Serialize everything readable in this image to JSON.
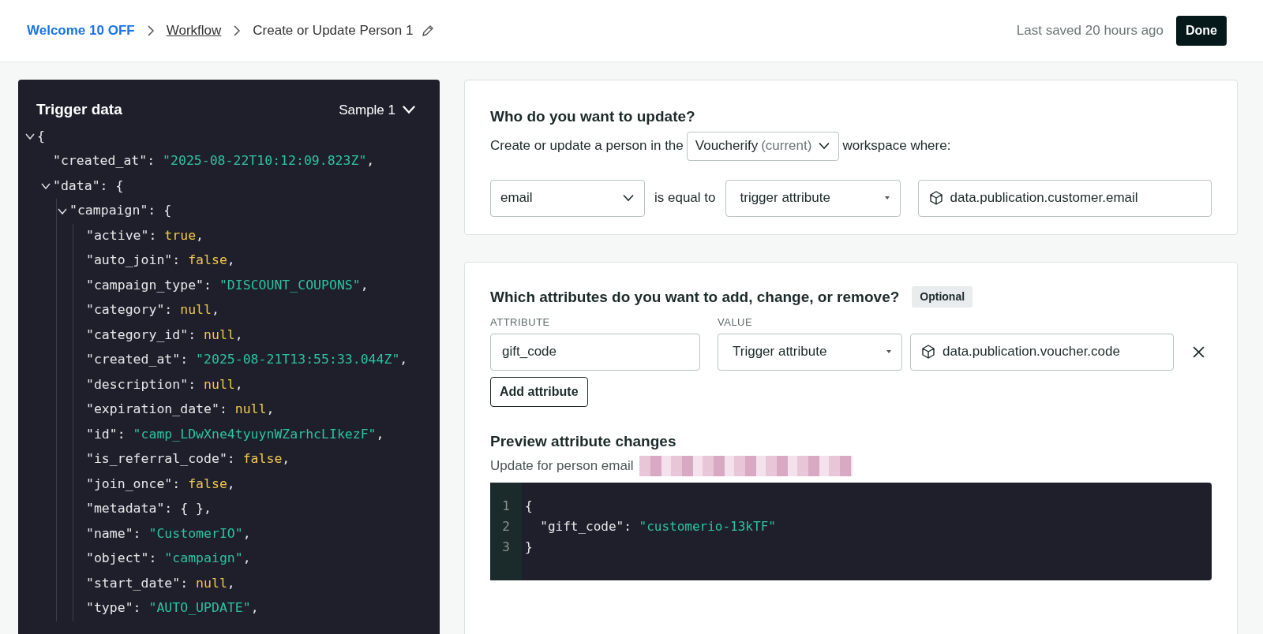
{
  "breadcrumb": [
    {
      "label": "Welcome 10 OFF",
      "kind": "link"
    },
    {
      "label": "Workflow",
      "kind": "underlined"
    },
    {
      "label": "Create or Update Person 1",
      "kind": "current"
    }
  ],
  "last_saved": "Last saved 20 hours ago",
  "done_button": "Done",
  "trigger_panel": {
    "title": "Trigger data",
    "sample": "Sample 1",
    "tree": {
      "open": "{",
      "expanded": true,
      "children": [
        {
          "key": "\"created_at\":",
          "value": "\"2025-08-22T10:12:09.823Z\"",
          "kind": "string",
          "tail": ","
        },
        {
          "key": "\"data\":",
          "open": "{",
          "expanded": true,
          "children": [
            {
              "key": "\"campaign\":",
              "open": "{",
              "expanded": true,
              "children": [
                {
                  "key": "\"active\":",
                  "value": "true",
                  "kind": "literal",
                  "tail": ","
                },
                {
                  "key": "\"auto_join\":",
                  "value": "false",
                  "kind": "literal",
                  "tail": ","
                },
                {
                  "key": "\"campaign_type\":",
                  "value": "\"DISCOUNT_COUPONS\"",
                  "kind": "string",
                  "tail": ","
                },
                {
                  "key": "\"category\":",
                  "value": "null",
                  "kind": "literal",
                  "tail": ","
                },
                {
                  "key": "\"category_id\":",
                  "value": "null",
                  "kind": "literal",
                  "tail": ","
                },
                {
                  "key": "\"created_at\":",
                  "value": "\"2025-08-21T13:55:33.044Z\"",
                  "kind": "string",
                  "tail": ","
                },
                {
                  "key": "\"description\":",
                  "value": "null",
                  "kind": "literal",
                  "tail": ","
                },
                {
                  "key": "\"expiration_date\":",
                  "value": "null",
                  "kind": "literal",
                  "tail": ","
                },
                {
                  "key": "\"id\":",
                  "value": "\"camp_LDwXne4tyuynWZarhcLIkezF\"",
                  "kind": "string",
                  "tail": ","
                },
                {
                  "key": "\"is_referral_code\":",
                  "value": "false",
                  "kind": "literal",
                  "tail": ","
                },
                {
                  "key": "\"join_once\":",
                  "value": "false",
                  "kind": "literal",
                  "tail": ","
                },
                {
                  "key": "\"metadata\":",
                  "value": "{ }",
                  "kind": "plain",
                  "tail": ","
                },
                {
                  "key": "\"name\":",
                  "value": "\"CustomerIO\"",
                  "kind": "string",
                  "tail": ","
                },
                {
                  "key": "\"object\":",
                  "value": "\"campaign\"",
                  "kind": "string",
                  "tail": ","
                },
                {
                  "key": "\"start_date\":",
                  "value": "null",
                  "kind": "literal",
                  "tail": ","
                },
                {
                  "key": "\"type\":",
                  "value": "\"AUTO_UPDATE\"",
                  "kind": "string",
                  "tail": ","
                }
              ]
            }
          ]
        }
      ]
    }
  },
  "who_card": {
    "title": "Who do you want to update?",
    "sentence_before": "Create or update a person in the",
    "workspace": {
      "name": "Voucherify",
      "note": "(current)"
    },
    "sentence_after": "workspace where:",
    "identifier": "email",
    "operator": "is equal to",
    "source": "trigger attribute",
    "attribute_path": "data.publication.customer.email"
  },
  "attributes_card": {
    "title": "Which attributes do you want to add, change, or remove?",
    "badge": "Optional",
    "columns": [
      "ATTRIBUTE",
      "VALUE"
    ],
    "rows": [
      {
        "attribute": "gift_code",
        "source": "Trigger attribute",
        "path": "data.publication.voucher.code"
      }
    ],
    "add_button": "Add attribute",
    "preview_title": "Preview attribute changes",
    "preview_caption": "Update for person email",
    "preview_lines": [
      {
        "number": "1",
        "parts": [
          {
            "text": "{",
            "kind": "plain"
          }
        ]
      },
      {
        "number": "2",
        "parts": [
          {
            "text": "  \"gift_code\": ",
            "kind": "plain"
          },
          {
            "text": "\"customerio-13kTF\"",
            "kind": "string"
          }
        ]
      },
      {
        "number": "3",
        "parts": [
          {
            "text": "}",
            "kind": "plain"
          }
        ]
      }
    ]
  }
}
